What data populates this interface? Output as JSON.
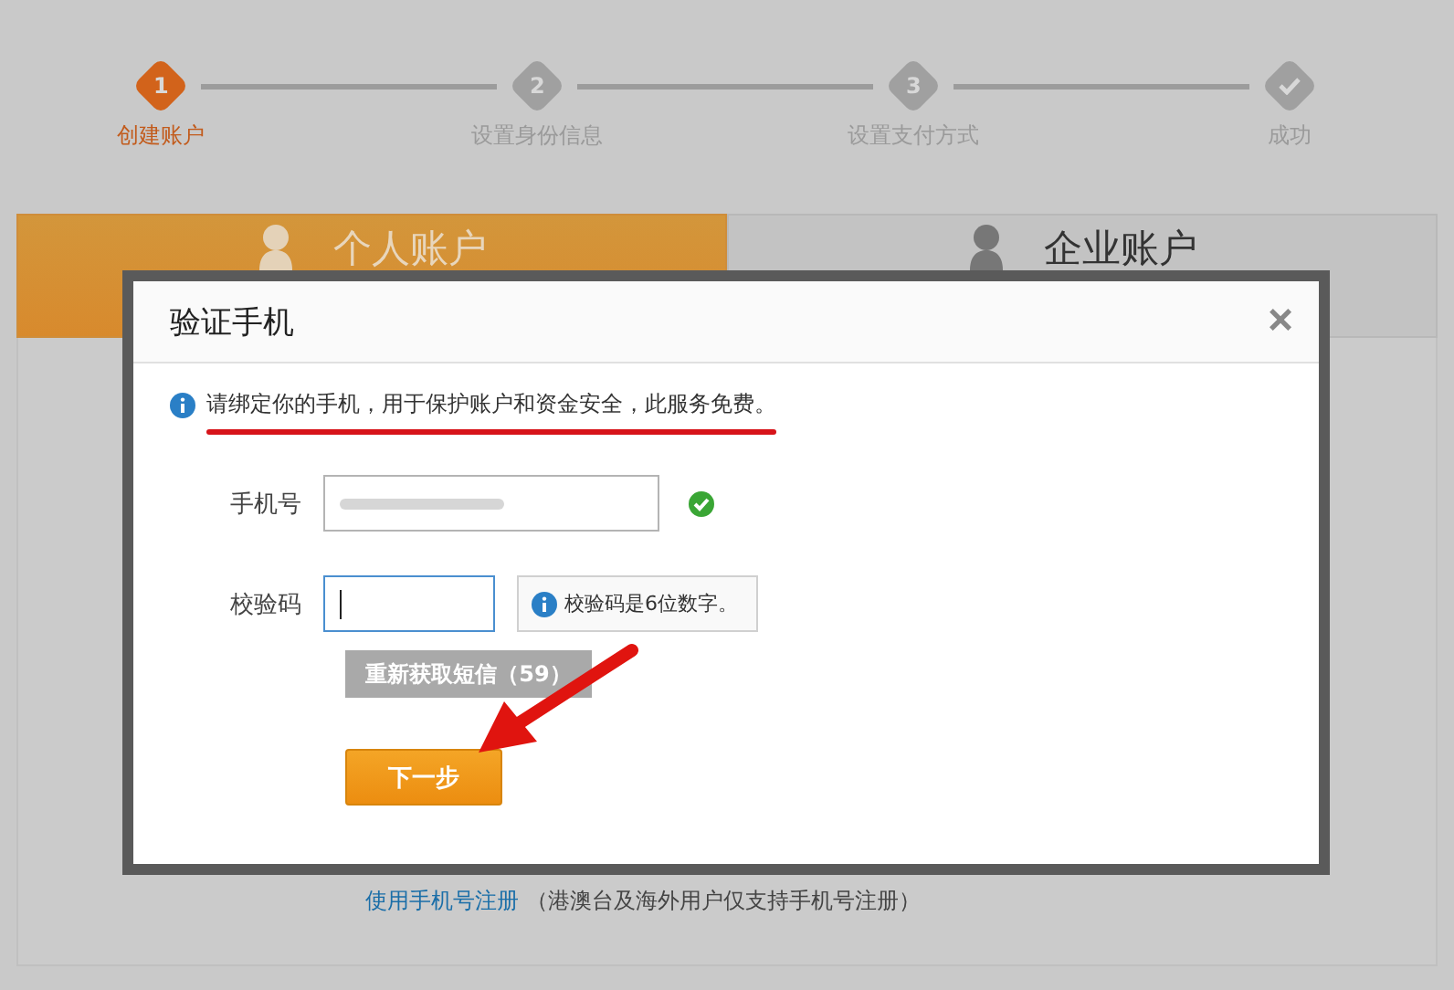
{
  "steps": [
    {
      "kind": "number",
      "number": "1",
      "label": "创建账户",
      "selected": true
    },
    {
      "kind": "number",
      "number": "2",
      "label": "设置身份信息",
      "selected": false
    },
    {
      "kind": "number",
      "number": "3",
      "label": "设置支付方式",
      "selected": false
    },
    {
      "kind": "check",
      "label": "成功",
      "selected": false
    }
  ],
  "account_tabs": [
    {
      "label": "个人账户",
      "selected": true
    },
    {
      "label": "企业账户",
      "selected": false
    }
  ],
  "footer": {
    "link": "使用手机号注册",
    "note": "（港澳台及海外用户仅支持手机号注册）"
  },
  "dialog": {
    "title": "验证手机",
    "close": "×",
    "notice": "请绑定你的手机，用于保护账户和资金安全，此服务免费。",
    "fields": [
      {
        "label": "手机号",
        "kind": "blurred",
        "valid": true,
        "focused": false
      },
      {
        "label": "校验码",
        "kind": "text",
        "valid": false,
        "focused": true,
        "hint": "校验码是6位数字。"
      }
    ],
    "resend_button": {
      "label": "重新获取短信（59）",
      "disabled": true
    },
    "next_button": {
      "label": "下一步"
    }
  },
  "annotations": {
    "underline_notice": true,
    "arrow_to_next": true
  }
}
